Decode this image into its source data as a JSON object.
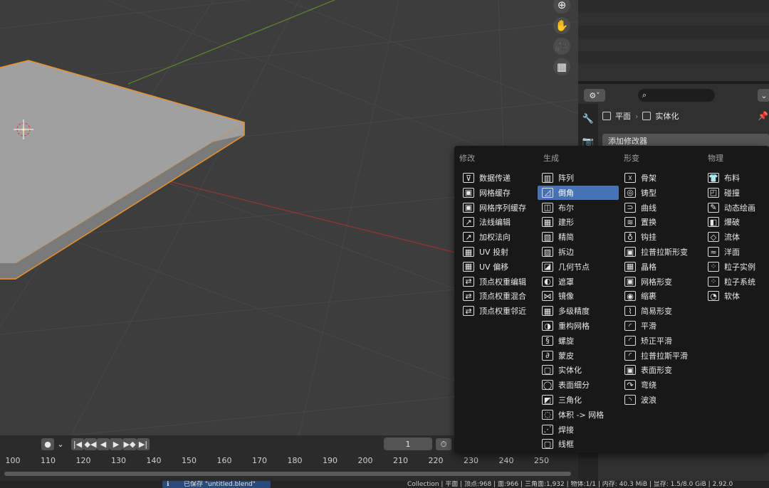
{
  "viewport": {
    "nav_icons": [
      "zoom-icon",
      "hand-pan-icon",
      "camera-icon",
      "grid-ortho-icon"
    ],
    "nav_glyphs": [
      "⊕",
      "✋",
      "🎥",
      "▦"
    ]
  },
  "properties": {
    "editor_type_icon": "⚙˅",
    "search_placeholder": "",
    "breadcrumb": {
      "object": "平面",
      "separator": "›",
      "modifier": "实体化"
    },
    "add_modifier_label": "添加修改器",
    "tab_icons": [
      "🔧",
      "📷",
      "⚙",
      "◐",
      "▤"
    ]
  },
  "modifier_menu": {
    "columns": [
      {
        "header": "修改",
        "items": [
          "数据传递",
          "网格缓存",
          "网格序列缓存",
          "法线编辑",
          "加权法向",
          "UV 投射",
          "UV 偏移",
          "顶点权重编辑",
          "顶点权重混合",
          "顶点权重邻近"
        ],
        "icons": [
          "⊽",
          "▣",
          "▣",
          "↗",
          "↗",
          "▦",
          "▦",
          "⇄",
          "⇄",
          "⇄"
        ]
      },
      {
        "header": "生成",
        "items": [
          "阵列",
          "倒角",
          "布尔",
          "建形",
          "精简",
          "拆边",
          "几何节点",
          "遮罩",
          "镜像",
          "多级精度",
          "重构网格",
          "螺旋",
          "蒙皮",
          "实体化",
          "表面细分",
          "三角化",
          "体积 -> 网格",
          "焊接",
          "线框"
        ],
        "icons": [
          "▥",
          "◿",
          "◫",
          "▦",
          "▧",
          "▨",
          "◪",
          "◐",
          "⋈",
          "▦",
          "◑",
          "§",
          "∂",
          "▢",
          "◯",
          "◩",
          "◌",
          "⋰",
          "▢"
        ],
        "active_index": 1
      },
      {
        "header": "形变",
        "items": [
          "骨架",
          "铸型",
          "曲线",
          "置换",
          "钩挂",
          "拉普拉斯形变",
          "晶格",
          "网格形变",
          "缩裹",
          "简易形变",
          "平滑",
          "矫正平滑",
          "拉普拉斯平滑",
          "表面形变",
          "弯绕",
          "波浪"
        ],
        "icons": [
          "☓",
          "◎",
          "⊃",
          "≋",
          "♁",
          "▣",
          "▦",
          "▣",
          "◉",
          "⌇",
          "◜",
          "◜",
          "◜",
          "▣",
          "↷",
          "◝"
        ]
      },
      {
        "header": "物理",
        "items": [
          "布料",
          "碰撞",
          "动态绘画",
          "爆破",
          "流体",
          "洋面",
          "粒子实例",
          "粒子系统",
          "软体"
        ],
        "icons": [
          "👕",
          "◰",
          "✎",
          "◧",
          "◇",
          "≈",
          "⁘",
          "⁘",
          "◔"
        ]
      }
    ]
  },
  "timeline": {
    "keyframe_dot": "●",
    "dropdown_arrow": "⌄",
    "transport_glyphs": [
      "|◀",
      "◆◀",
      "◀",
      "▶",
      "▶◆",
      "▶|"
    ],
    "current_frame": "1",
    "stopwatch_glyph": "⏱",
    "ticks": [
      "100",
      "110",
      "120",
      "130",
      "140",
      "150",
      "160",
      "170",
      "180",
      "190",
      "200",
      "210",
      "220",
      "230",
      "240",
      "250"
    ]
  },
  "statusbar": {
    "info_icon": "ℹ",
    "message": "已保存 \"untitled.blend\"",
    "stats": "Collection | 平面 | 顶点:968 | 面:966 | 三角面:1,932 | 物体:1/1 | 内存: 40.3 MiB | 显存: 1.5/8.0 GiB | 2.92.0"
  },
  "colors": {
    "selection_outline": "#e8912b",
    "active_item": "#4772b3",
    "x_axis": "#9a3434",
    "y_axis": "#5e8a2f",
    "annotation_arrow": "#e0251f"
  }
}
